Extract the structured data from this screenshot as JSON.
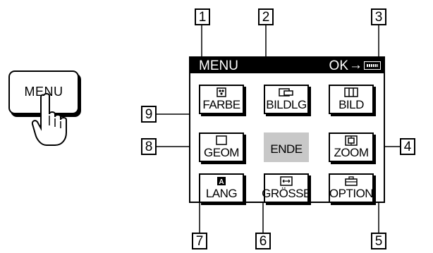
{
  "hardware_button": {
    "label": "MENU"
  },
  "menu": {
    "title": "MENU",
    "ok_hint": "OK",
    "arrow": "→",
    "menu_key_icon": "menu-key-icon",
    "items": [
      {
        "label": "FARBE",
        "icon": "color-dots-icon"
      },
      {
        "label": "BILDLG",
        "icon": "screen-position-icon"
      },
      {
        "label": "BILD",
        "icon": "picture-adjust-icon"
      },
      {
        "label": "GEOM",
        "icon": "geometry-square-icon"
      },
      {
        "label": "ENDE",
        "icon": "",
        "selected": true
      },
      {
        "label": "ZOOM",
        "icon": "zoom-icon"
      },
      {
        "label": "LANG",
        "icon": "language-icon"
      },
      {
        "label": "GRÖSSE",
        "icon": "size-icon"
      },
      {
        "label": "OPTION",
        "icon": "option-toolbox-icon"
      }
    ]
  },
  "callouts": [
    "1",
    "2",
    "3",
    "4",
    "5",
    "6",
    "7",
    "8",
    "9"
  ]
}
